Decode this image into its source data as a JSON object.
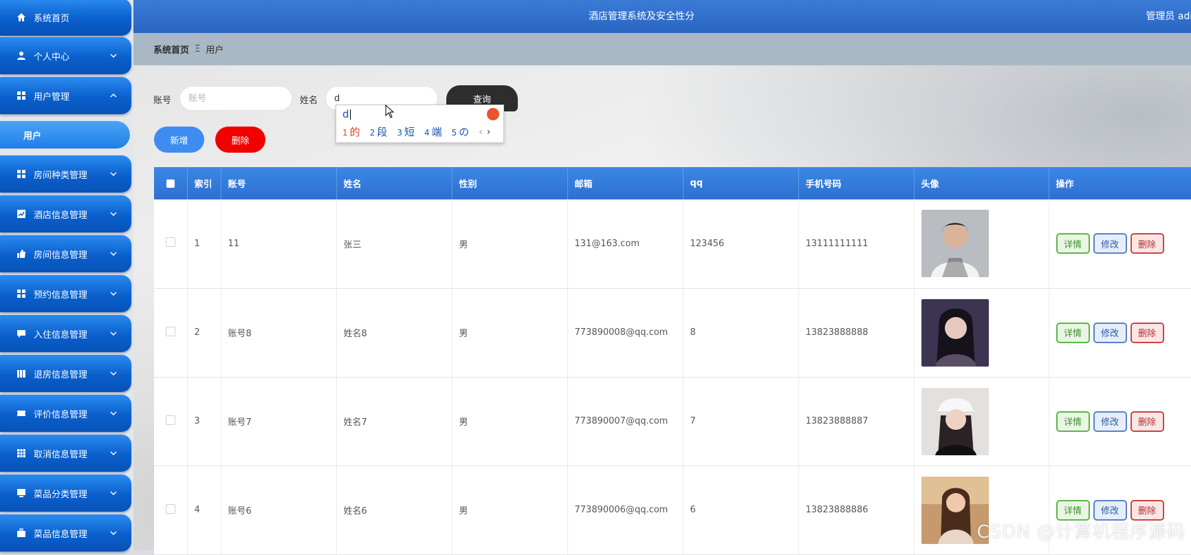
{
  "header": {
    "title": "酒店管理系统及安全性分",
    "user": "管理员 adm"
  },
  "breadcrumb": {
    "home": "系统首页",
    "sep": "Ξ",
    "current": "用户"
  },
  "sidebar": {
    "items": [
      {
        "label": "系统首页",
        "icon": "home-icon"
      },
      {
        "label": "个人中心",
        "icon": "user-icon"
      },
      {
        "label": "用户管理",
        "icon": "grid-icon"
      },
      {
        "label": "房间种类管理",
        "icon": "grid-icon"
      },
      {
        "label": "酒店信息管理",
        "icon": "chart-icon"
      },
      {
        "label": "房间信息管理",
        "icon": "thumb-icon"
      },
      {
        "label": "预约信息管理",
        "icon": "grid-icon"
      },
      {
        "label": "入住信息管理",
        "icon": "chat-icon"
      },
      {
        "label": "退房信息管理",
        "icon": "book-icon"
      },
      {
        "label": "评价信息管理",
        "icon": "ticket-icon"
      },
      {
        "label": "取消信息管理",
        "icon": "table-icon"
      },
      {
        "label": "菜品分类管理",
        "icon": "monitor-icon"
      },
      {
        "label": "菜品信息管理",
        "icon": "briefcase-icon"
      }
    ],
    "sub_item": "用户"
  },
  "search": {
    "account_label": "账号",
    "account_placeholder": "账号",
    "name_label": "姓名",
    "name_value": "d",
    "query_button": "查询"
  },
  "actions": {
    "add": "新增",
    "delete": "删除"
  },
  "ime": {
    "composition": "d",
    "candidates": [
      {
        "n": "1",
        "t": "的"
      },
      {
        "n": "2",
        "t": "段"
      },
      {
        "n": "3",
        "t": "短"
      },
      {
        "n": "4",
        "t": "端"
      },
      {
        "n": "5",
        "t": "の"
      }
    ],
    "prev": "‹",
    "next": "›"
  },
  "table": {
    "columns": [
      "索引",
      "账号",
      "姓名",
      "性别",
      "邮箱",
      "qq",
      "手机号码",
      "头像",
      "操作"
    ],
    "ops": {
      "detail": "详情",
      "edit": "修改",
      "delete": "删除"
    },
    "rows": [
      {
        "index": "1",
        "account": "11",
        "name": "张三",
        "gender": "男",
        "email": "131@163.com",
        "qq": "123456",
        "phone": "13111111111",
        "avatar_color": "#5b5f66"
      },
      {
        "index": "2",
        "account": "账号8",
        "name": "姓名8",
        "gender": "男",
        "email": "773890008@qq.com",
        "qq": "8",
        "phone": "13823888888",
        "avatar_color": "#3c3450"
      },
      {
        "index": "3",
        "account": "账号7",
        "name": "姓名7",
        "gender": "男",
        "email": "773890007@qq.com",
        "qq": "7",
        "phone": "13823888887",
        "avatar_color": "#cfc6c2"
      },
      {
        "index": "4",
        "account": "账号6",
        "name": "姓名6",
        "gender": "男",
        "email": "773890006@qq.com",
        "qq": "6",
        "phone": "13823888886",
        "avatar_color": "#c69a6e"
      }
    ]
  },
  "watermark": "CSDN @计算机程序源码"
}
